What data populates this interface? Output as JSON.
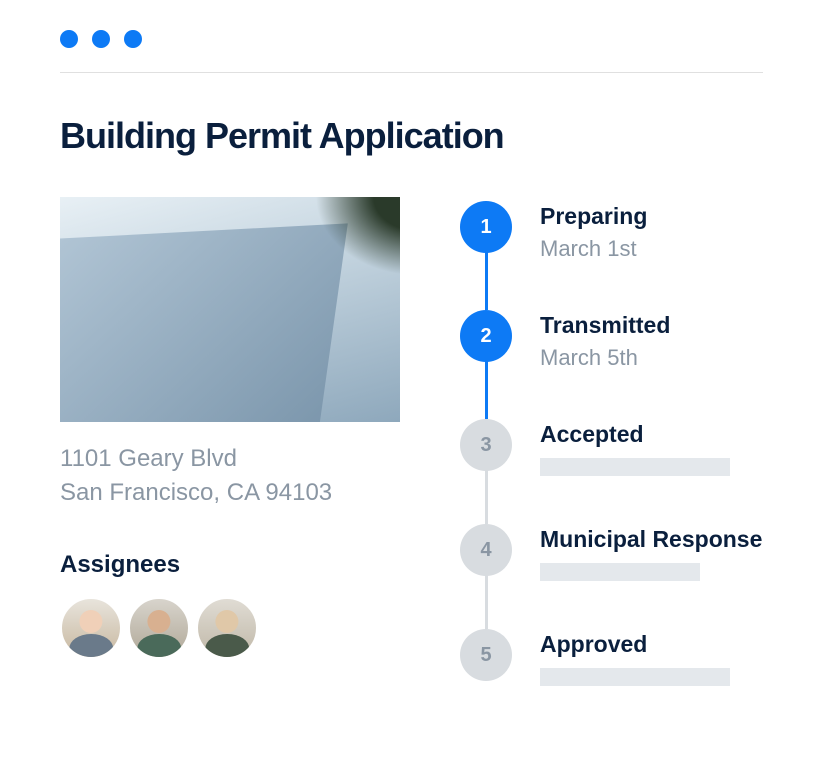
{
  "title": "Building Permit Application",
  "address": {
    "line1": "1101 Geary Blvd",
    "line2": "San Francisco, CA 94103"
  },
  "assignees": {
    "label": "Assignees",
    "count": 3
  },
  "timeline": [
    {
      "num": "1",
      "title": "Preparing",
      "date": "March 1st",
      "active": true
    },
    {
      "num": "2",
      "title": "Transmitted",
      "date": "March 5th",
      "active": true
    },
    {
      "num": "3",
      "title": "Accepted",
      "date": null,
      "active": false
    },
    {
      "num": "4",
      "title": "Municipal Response",
      "date": null,
      "active": false
    },
    {
      "num": "5",
      "title": "Approved",
      "date": null,
      "active": false
    }
  ]
}
